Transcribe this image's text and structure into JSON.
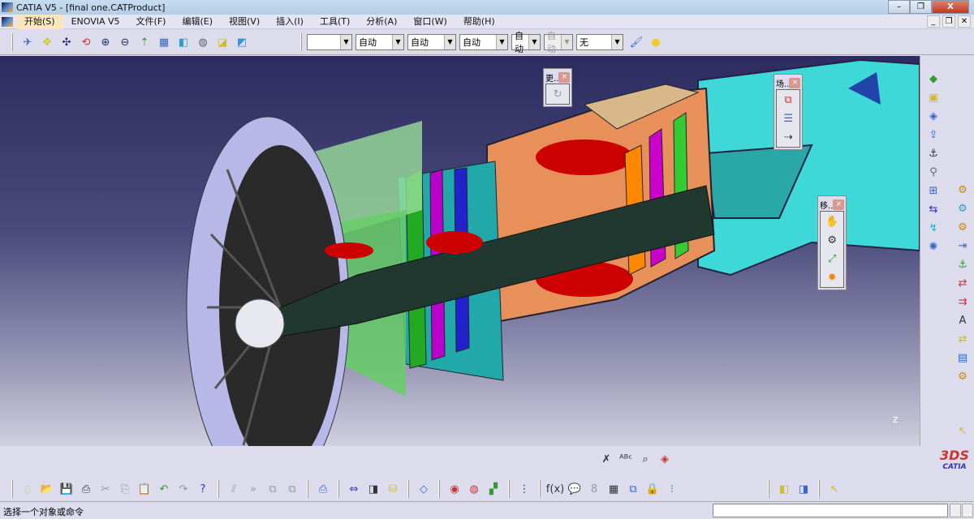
{
  "window": {
    "title": "CATIA V5 - [final one.CATProduct]",
    "min": "–",
    "restore": "❐",
    "close": "X"
  },
  "menu": {
    "items": [
      {
        "label": "开始(S)",
        "active": true
      },
      {
        "label": "ENOVIA V5"
      },
      {
        "label": "文件(F)"
      },
      {
        "label": "编辑(E)"
      },
      {
        "label": "视图(V)"
      },
      {
        "label": "插入(I)"
      },
      {
        "label": "工具(T)"
      },
      {
        "label": "分析(A)"
      },
      {
        "label": "窗口(W)"
      },
      {
        "label": "帮助(H)"
      }
    ],
    "doc_min": "_",
    "doc_restore": "❐",
    "doc_close": "✕"
  },
  "toolbar": {
    "view_icons": [
      {
        "name": "fly-mode-icon",
        "glyph": "✈",
        "color": "#36c"
      },
      {
        "name": "fit-all-icon",
        "glyph": "✥",
        "color": "#cc0"
      },
      {
        "name": "pan-icon",
        "glyph": "✣",
        "color": "#228"
      },
      {
        "name": "rotate-icon",
        "glyph": "⟲",
        "color": "#c33"
      },
      {
        "name": "zoom-in-icon",
        "glyph": "⊕",
        "color": "#236"
      },
      {
        "name": "zoom-out-icon",
        "glyph": "⊖",
        "color": "#236"
      },
      {
        "name": "normal-view-icon",
        "glyph": "⇡",
        "color": "#393"
      },
      {
        "name": "multi-view-icon",
        "glyph": "▦",
        "color": "#36c"
      },
      {
        "name": "iso-view-icon",
        "glyph": "◧",
        "color": "#39c"
      },
      {
        "name": "shading-icon",
        "glyph": "◍",
        "color": "#566"
      },
      {
        "name": "hide-show-icon",
        "glyph": "◪",
        "color": "#cb3"
      },
      {
        "name": "swap-space-icon",
        "glyph": "◩",
        "color": "#39c"
      }
    ],
    "combos": [
      {
        "value": "",
        "disabled": false,
        "w": 56
      },
      {
        "value": "自动",
        "disabled": false,
        "w": 60
      },
      {
        "value": "自动",
        "disabled": false,
        "w": 60
      },
      {
        "value": "自动",
        "disabled": false,
        "w": 60
      },
      {
        "value": "自动",
        "disabled": false,
        "w": 36
      },
      {
        "value": "自动",
        "disabled": true,
        "w": 36
      },
      {
        "value": "无",
        "disabled": false,
        "w": 58
      }
    ],
    "paint_icons": [
      {
        "name": "painter-icon",
        "glyph": "🖌",
        "color": "#36c"
      },
      {
        "name": "material-icon",
        "glyph": "●",
        "color": "#ec3"
      }
    ]
  },
  "floating": [
    {
      "title": "更..",
      "icons": [
        {
          "name": "update-icon",
          "glyph": "↻",
          "color": "#999"
        }
      ]
    },
    {
      "title": "场..",
      "icons": [
        {
          "name": "scene-explode-icon",
          "glyph": "⧉",
          "color": "#c33"
        },
        {
          "name": "scene-list-icon",
          "glyph": "☰",
          "color": "#36c"
        },
        {
          "name": "scene-apply-icon",
          "glyph": "⇢",
          "color": "#333"
        }
      ]
    },
    {
      "title": "移..",
      "icons": [
        {
          "name": "manipulate-icon",
          "glyph": "✋",
          "color": "#36c"
        },
        {
          "name": "snap-icon",
          "glyph": "⚙",
          "color": "#333"
        },
        {
          "name": "smart-move-icon",
          "glyph": "⤢",
          "color": "#393"
        },
        {
          "name": "explode-icon",
          "glyph": "✸",
          "color": "#e80"
        }
      ]
    }
  ],
  "right_toolbar": {
    "col1": [
      {
        "name": "product-icon",
        "glyph": "◆",
        "color": "#393"
      },
      {
        "name": "part-icon",
        "glyph": "▣",
        "color": "#cb3"
      },
      {
        "name": "component-icon",
        "glyph": "◈",
        "color": "#36c"
      },
      {
        "name": "existing-component-icon",
        "glyph": "⇪",
        "color": "#36c"
      },
      {
        "name": "position-icon",
        "glyph": "⚓",
        "color": "#333"
      },
      {
        "name": "replace-icon",
        "glyph": "⚲",
        "color": "#666"
      },
      {
        "name": "graph-tree-icon",
        "glyph": "⊞",
        "color": "#36c"
      },
      {
        "name": "renumber-icon",
        "glyph": "⇆",
        "color": "#33c"
      },
      {
        "name": "reorder-icon",
        "glyph": "↯",
        "color": "#0bc"
      },
      {
        "name": "multi-instance-icon",
        "glyph": "✺",
        "color": "#36c"
      }
    ],
    "col2": [
      {
        "name": "coincidence-icon",
        "glyph": "⚙",
        "color": "#c80"
      },
      {
        "name": "contact-icon",
        "glyph": "⚙",
        "color": "#39c"
      },
      {
        "name": "offset-icon",
        "glyph": "⚙",
        "color": "#c80"
      },
      {
        "name": "angle-icon",
        "glyph": "⇥",
        "color": "#36c"
      },
      {
        "name": "fix-icon",
        "glyph": "⚓",
        "color": "#393"
      },
      {
        "name": "fix-together-icon",
        "glyph": "⇄",
        "color": "#c33"
      },
      {
        "name": "quick-constraint-icon",
        "glyph": "⇉",
        "color": "#c33"
      },
      {
        "name": "flexible-icon",
        "glyph": "A",
        "color": "#333"
      },
      {
        "name": "change-constraint-icon",
        "glyph": "⇄",
        "color": "#cb3"
      },
      {
        "name": "reuse-pattern-icon",
        "glyph": "▤",
        "color": "#36c"
      },
      {
        "name": "update-all-icon",
        "glyph": "⚙",
        "color": "#c80"
      }
    ],
    "select_icon": {
      "name": "select-icon",
      "glyph": "↖",
      "color": "#cb3"
    }
  },
  "bottom_toolbar": {
    "top_row": [
      {
        "name": "annotation-text-icon",
        "glyph": "✗",
        "color": "#333"
      },
      {
        "name": "text-leader-icon",
        "glyph": "ᴬᴮᶜ",
        "color": "#333"
      },
      {
        "name": "flag-note-icon",
        "glyph": "⌕",
        "color": "#333"
      },
      {
        "name": "view-annotation-icon",
        "glyph": "◈",
        "color": "#c33"
      }
    ],
    "groups": [
      [
        {
          "name": "new-icon",
          "glyph": "▯",
          "color": "#cc9"
        },
        {
          "name": "open-icon",
          "glyph": "📂",
          "color": "#cb3"
        },
        {
          "name": "save-icon",
          "glyph": "💾",
          "color": "#333"
        },
        {
          "name": "print-icon",
          "glyph": "⎙",
          "color": "#333"
        },
        {
          "name": "cut-icon",
          "glyph": "✂",
          "color": "#999"
        },
        {
          "name": "copy-icon",
          "glyph": "⎘",
          "color": "#999"
        },
        {
          "name": "paste-icon",
          "glyph": "📋",
          "color": "#999"
        },
        {
          "name": "undo-icon",
          "glyph": "↶",
          "color": "#393"
        },
        {
          "name": "redo-icon",
          "glyph": "↷",
          "color": "#999"
        },
        {
          "name": "whats-this-icon",
          "glyph": "?",
          "color": "#33a"
        }
      ],
      [
        {
          "name": "free-space-icon",
          "glyph": "⫽",
          "color": "#999"
        },
        {
          "name": "next-icon",
          "glyph": "»",
          "color": "#999"
        },
        {
          "name": "clone-icon",
          "glyph": "⧉",
          "color": "#999"
        },
        {
          "name": "clone2-icon",
          "glyph": "⧉",
          "color": "#999"
        }
      ],
      [
        {
          "name": "catalog-icon",
          "glyph": "⎙",
          "color": "#36c"
        }
      ],
      [
        {
          "name": "measure-between-icon",
          "glyph": "⇔",
          "color": "#33a"
        },
        {
          "name": "measure-item-icon",
          "glyph": "◨",
          "color": "#333"
        },
        {
          "name": "measure-inertia-icon",
          "glyph": "⛁",
          "color": "#cb3"
        }
      ],
      [
        {
          "name": "sketch-icon",
          "glyph": "◇",
          "color": "#36c"
        }
      ],
      [
        {
          "name": "render-icon",
          "glyph": "◉",
          "color": "#c33"
        },
        {
          "name": "environment-icon",
          "glyph": "◍",
          "color": "#c33"
        },
        {
          "name": "apply-material-icon",
          "glyph": "▞",
          "color": "#393"
        }
      ],
      [
        {
          "name": "multi-compass-icon",
          "glyph": "⋮",
          "color": "#333"
        }
      ],
      [
        {
          "name": "formula-icon",
          "glyph": "f(x)",
          "color": "#333"
        },
        {
          "name": "comment-icon",
          "glyph": "💬",
          "color": "#333"
        },
        {
          "name": "link-icon",
          "glyph": "8",
          "color": "#999"
        },
        {
          "name": "table-icon",
          "glyph": "▦",
          "color": "#333"
        },
        {
          "name": "hierarchy-icon",
          "glyph": "⧉",
          "color": "#36c"
        },
        {
          "name": "lock-icon",
          "glyph": "🔒",
          "color": "#333"
        },
        {
          "name": "parameters-icon",
          "glyph": "⁝",
          "color": "#393"
        }
      ],
      [
        {
          "name": "publish-icon",
          "glyph": "◧",
          "color": "#cb3"
        },
        {
          "name": "publish2-icon",
          "glyph": "◨",
          "color": "#36c"
        }
      ],
      [
        {
          "name": "cursor-icon",
          "glyph": "↖",
          "color": "#cb3"
        }
      ]
    ]
  },
  "logo": {
    "text": "CATIA"
  },
  "status": {
    "text": "选择一个对象或命令",
    "input": ""
  }
}
